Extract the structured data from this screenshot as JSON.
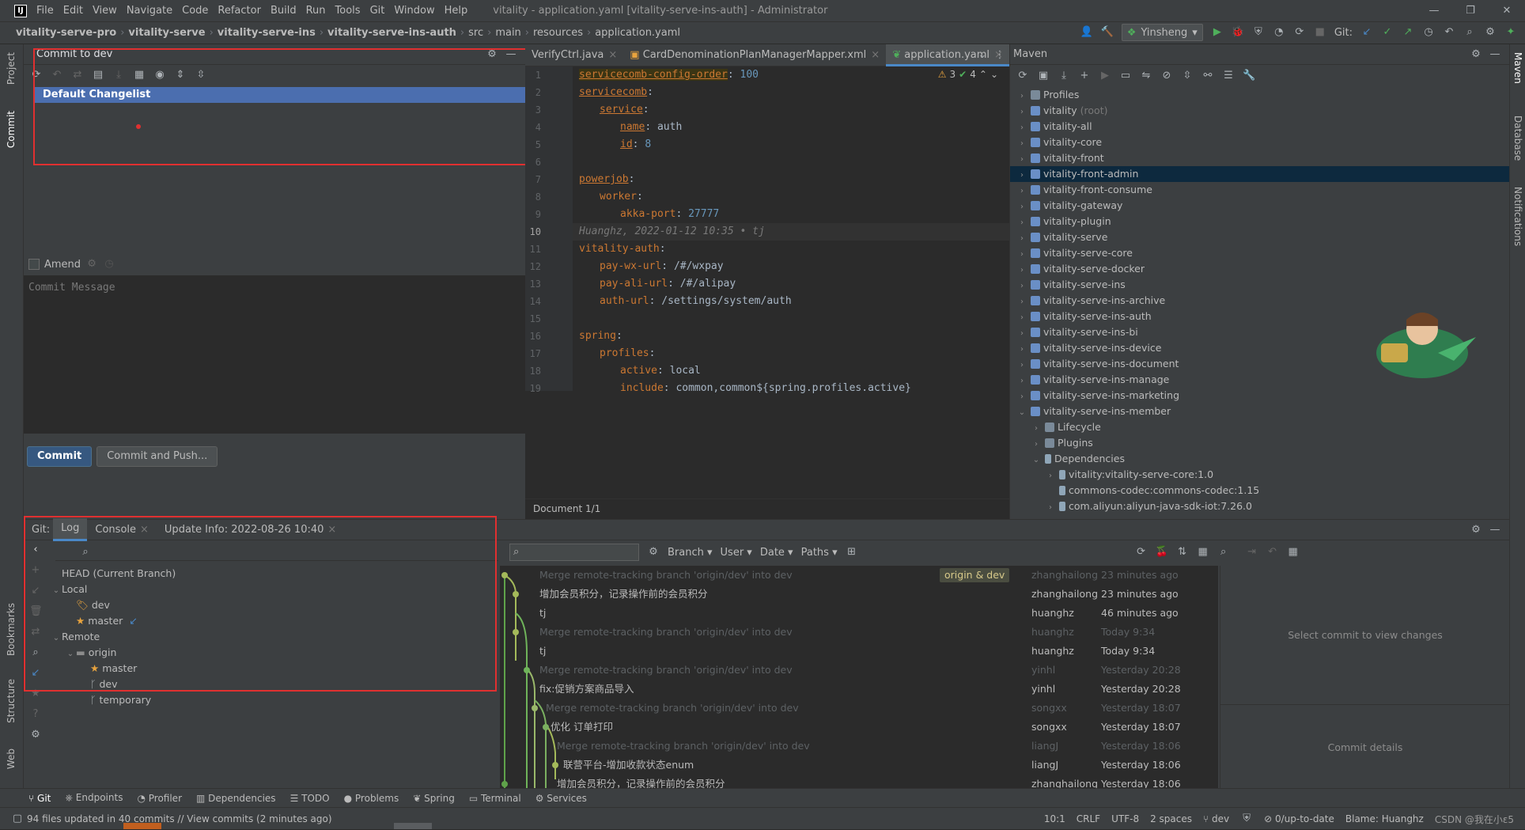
{
  "window": {
    "title": "vitality - application.yaml [vitality-serve-ins-auth] - Administrator",
    "menu": [
      "File",
      "Edit",
      "View",
      "Navigate",
      "Code",
      "Refactor",
      "Build",
      "Run",
      "Tools",
      "Git",
      "Window",
      "Help"
    ]
  },
  "breadcrumb": [
    "vitality-serve-pro",
    "vitality-serve",
    "vitality-serve-ins",
    "vitality-serve-ins-auth",
    "src",
    "main",
    "resources",
    "application.yaml"
  ],
  "toolbar": {
    "run_config": "Yinsheng",
    "git_label": "Git:"
  },
  "side_tabs": {
    "project": "Project",
    "commit": "Commit",
    "bookmarks": "Bookmarks",
    "structure": "Structure",
    "web": "Web",
    "maven": "Maven",
    "database": "Database",
    "notifications": "Notifications"
  },
  "commit": {
    "title": "Commit to dev",
    "changelist": "Default Changelist",
    "amend": "Amend",
    "message_placeholder": "Commit Message",
    "commit_btn": "Commit",
    "commit_push_btn": "Commit and Push..."
  },
  "editor": {
    "tabs": [
      "VerifyCtrl.java",
      "CardDenominationPlanManagerMapper.xml",
      "application.yaml"
    ],
    "active_tab": "application.yaml",
    "inspections": {
      "warnings": "3",
      "ok": "4"
    },
    "lines": [
      {
        "n": "1",
        "key": "servicecomb-config-order",
        "sep": ": ",
        "val": "100",
        "indent": 0,
        "num": true
      },
      {
        "n": "2",
        "key": "servicecomb",
        "sep": ":",
        "val": "",
        "indent": 0
      },
      {
        "n": "3",
        "key": "service",
        "sep": ":",
        "val": "",
        "indent": 1
      },
      {
        "n": "4",
        "key": "name",
        "sep": ": ",
        "val": "auth",
        "indent": 2
      },
      {
        "n": "5",
        "key": "id",
        "sep": ": ",
        "val": "8",
        "indent": 2,
        "num": true
      },
      {
        "n": "6",
        "key": "",
        "sep": "",
        "val": "",
        "indent": 0
      },
      {
        "n": "7",
        "key": "powerjob",
        "sep": ":",
        "val": "",
        "indent": 0
      },
      {
        "n": "8",
        "key": "worker",
        "sep": ":",
        "val": "",
        "indent": 1
      },
      {
        "n": "9",
        "key": "akka-port",
        "sep": ": ",
        "val": "27777",
        "indent": 2,
        "num": true
      },
      {
        "n": "10",
        "key": "",
        "sep": "",
        "val": "",
        "indent": 0,
        "annot": "Huanghz, 2022-01-12 10:35 • tj"
      },
      {
        "n": "11",
        "key": "vitality-auth",
        "sep": ":",
        "val": "",
        "indent": 0
      },
      {
        "n": "12",
        "key": "pay-wx-url",
        "sep": ": ",
        "val": "/#/wxpay",
        "indent": 1
      },
      {
        "n": "13",
        "key": "pay-ali-url",
        "sep": ": ",
        "val": "/#/alipay",
        "indent": 1
      },
      {
        "n": "14",
        "key": "auth-url",
        "sep": ": ",
        "val": "/settings/system/auth",
        "indent": 1
      },
      {
        "n": "15",
        "key": "",
        "sep": "",
        "val": "",
        "indent": 0
      },
      {
        "n": "16",
        "key": "spring",
        "sep": ":",
        "val": "",
        "indent": 0
      },
      {
        "n": "17",
        "key": "profiles",
        "sep": ":",
        "val": "",
        "indent": 1
      },
      {
        "n": "18",
        "key": "active",
        "sep": ": ",
        "val": "local",
        "indent": 2
      },
      {
        "n": "19",
        "key": "include",
        "sep": ": ",
        "val": "common,common${spring.profiles.active}",
        "indent": 2
      }
    ],
    "footer": "Document 1/1"
  },
  "maven": {
    "title": "Maven",
    "items": [
      {
        "label": "Profiles",
        "depth": 0,
        "open": false,
        "kind": "folder"
      },
      {
        "label": "vitality",
        "suffix": " (root)",
        "depth": 0,
        "open": false,
        "kind": "module"
      },
      {
        "label": "vitality-all",
        "depth": 0,
        "open": false,
        "kind": "module"
      },
      {
        "label": "vitality-core",
        "depth": 0,
        "open": false,
        "kind": "module"
      },
      {
        "label": "vitality-front",
        "depth": 0,
        "open": false,
        "kind": "module"
      },
      {
        "label": "vitality-front-admin",
        "depth": 0,
        "open": false,
        "kind": "module",
        "selected": true
      },
      {
        "label": "vitality-front-consume",
        "depth": 0,
        "open": false,
        "kind": "module"
      },
      {
        "label": "vitality-gateway",
        "depth": 0,
        "open": false,
        "kind": "module"
      },
      {
        "label": "vitality-plugin",
        "depth": 0,
        "open": false,
        "kind": "module"
      },
      {
        "label": "vitality-serve",
        "depth": 0,
        "open": false,
        "kind": "module"
      },
      {
        "label": "vitality-serve-core",
        "depth": 0,
        "open": false,
        "kind": "module"
      },
      {
        "label": "vitality-serve-docker",
        "depth": 0,
        "open": false,
        "kind": "module"
      },
      {
        "label": "vitality-serve-ins",
        "depth": 0,
        "open": false,
        "kind": "module"
      },
      {
        "label": "vitality-serve-ins-archive",
        "depth": 0,
        "open": false,
        "kind": "module"
      },
      {
        "label": "vitality-serve-ins-auth",
        "depth": 0,
        "open": false,
        "kind": "module"
      },
      {
        "label": "vitality-serve-ins-bi",
        "depth": 0,
        "open": false,
        "kind": "module"
      },
      {
        "label": "vitality-serve-ins-device",
        "depth": 0,
        "open": false,
        "kind": "module"
      },
      {
        "label": "vitality-serve-ins-document",
        "depth": 0,
        "open": false,
        "kind": "module"
      },
      {
        "label": "vitality-serve-ins-manage",
        "depth": 0,
        "open": false,
        "kind": "module"
      },
      {
        "label": "vitality-serve-ins-marketing",
        "depth": 0,
        "open": false,
        "kind": "module"
      },
      {
        "label": "vitality-serve-ins-member",
        "depth": 0,
        "open": true,
        "kind": "module"
      },
      {
        "label": "Lifecycle",
        "depth": 1,
        "open": false,
        "kind": "folder"
      },
      {
        "label": "Plugins",
        "depth": 1,
        "open": false,
        "kind": "folder"
      },
      {
        "label": "Dependencies",
        "depth": 1,
        "open": true,
        "kind": "deps"
      },
      {
        "label": "vitality:vitality-serve-core:1.0",
        "depth": 2,
        "open": false,
        "kind": "dep"
      },
      {
        "label": "commons-codec:commons-codec:1.15",
        "depth": 2,
        "open": null,
        "kind": "dep"
      },
      {
        "label": "com.aliyun:aliyun-java-sdk-iot:7.26.0",
        "depth": 2,
        "open": false,
        "kind": "dep"
      }
    ]
  },
  "git": {
    "label": "Git:",
    "tabs": [
      "Log",
      "Console",
      "Update Info: 2022-08-26 10:40"
    ],
    "active_tab": "Log",
    "filters": {
      "branch": "Branch",
      "user": "User",
      "date": "Date",
      "paths": "Paths"
    },
    "branches": [
      {
        "label": "HEAD (Current Branch)",
        "depth": 0,
        "caret": null,
        "icon": ""
      },
      {
        "label": "Local",
        "depth": 0,
        "caret": "open",
        "icon": ""
      },
      {
        "label": "dev",
        "depth": 1,
        "caret": null,
        "icon": "tag"
      },
      {
        "label": "master",
        "depth": 1,
        "caret": null,
        "icon": "star",
        "extra": "↙"
      },
      {
        "label": "Remote",
        "depth": 0,
        "caret": "open",
        "icon": ""
      },
      {
        "label": "origin",
        "depth": 1,
        "caret": "open",
        "icon": "folder"
      },
      {
        "label": "master",
        "depth": 2,
        "caret": null,
        "icon": "star"
      },
      {
        "label": "dev",
        "depth": 2,
        "caret": null,
        "icon": "branch"
      },
      {
        "label": "temporary",
        "depth": 2,
        "caret": null,
        "icon": "branch"
      }
    ],
    "commits": [
      {
        "msg": "Merge remote-tracking branch 'origin/dev' into dev",
        "author": "zhanghailong",
        "date": "23 minutes ago",
        "faded": true,
        "tag": "origin & dev",
        "indent": 50
      },
      {
        "msg": "增加会员积分，记录操作前的会员积分",
        "author": "zhanghailong",
        "date": "23 minutes ago",
        "faded": false,
        "indent": 50
      },
      {
        "msg": "tj",
        "author": "huanghz",
        "date": "46 minutes ago",
        "faded": false,
        "indent": 50
      },
      {
        "msg": "Merge remote-tracking branch 'origin/dev' into dev",
        "author": "huanghz",
        "date": "Today 9:34",
        "faded": true,
        "indent": 50
      },
      {
        "msg": "tj",
        "author": "huanghz",
        "date": "Today 9:34",
        "faded": false,
        "indent": 50
      },
      {
        "msg": "Merge remote-tracking branch 'origin/dev' into dev",
        "author": "yinhl",
        "date": "Yesterday 20:28",
        "faded": true,
        "indent": 50
      },
      {
        "msg": "fix:促销方案商品导入",
        "author": "yinhl",
        "date": "Yesterday 20:28",
        "faded": false,
        "indent": 50
      },
      {
        "msg": "Merge remote-tracking branch 'origin/dev' into dev",
        "author": "songxx",
        "date": "Yesterday 18:07",
        "faded": true,
        "indent": 58
      },
      {
        "msg": "优化  订单打印",
        "author": "songxx",
        "date": "Yesterday 18:07",
        "faded": false,
        "indent": 64
      },
      {
        "msg": "Merge remote-tracking branch 'origin/dev' into dev",
        "author": "liangJ",
        "date": "Yesterday 18:06",
        "faded": true,
        "indent": 72
      },
      {
        "msg": "联营平台-增加收款状态enum",
        "author": "liangJ",
        "date": "Yesterday 18:06",
        "faded": false,
        "indent": 80
      },
      {
        "msg": "增加会员积分，记录操作前的会员积分",
        "author": "zhanghailong",
        "date": "Yesterday 18:06",
        "faded": false,
        "indent": 72
      }
    ],
    "select_hint": "Select commit to view changes",
    "details_hint": "Commit details"
  },
  "tool_windows": [
    "Git",
    "Endpoints",
    "Profiler",
    "Dependencies",
    "TODO",
    "Problems",
    "Spring",
    "Terminal",
    "Services"
  ],
  "status": {
    "left": "94 files updated in 40 commits // View commits (2 minutes ago)",
    "pos": "10:1",
    "eol": "CRLF",
    "enc": "UTF-8",
    "indent": "2 spaces",
    "branch": "dev",
    "uptodate": "0/up-to-date",
    "blame": "Blame: Huanghz",
    "watermark": "CSDN @我在小ε5"
  }
}
